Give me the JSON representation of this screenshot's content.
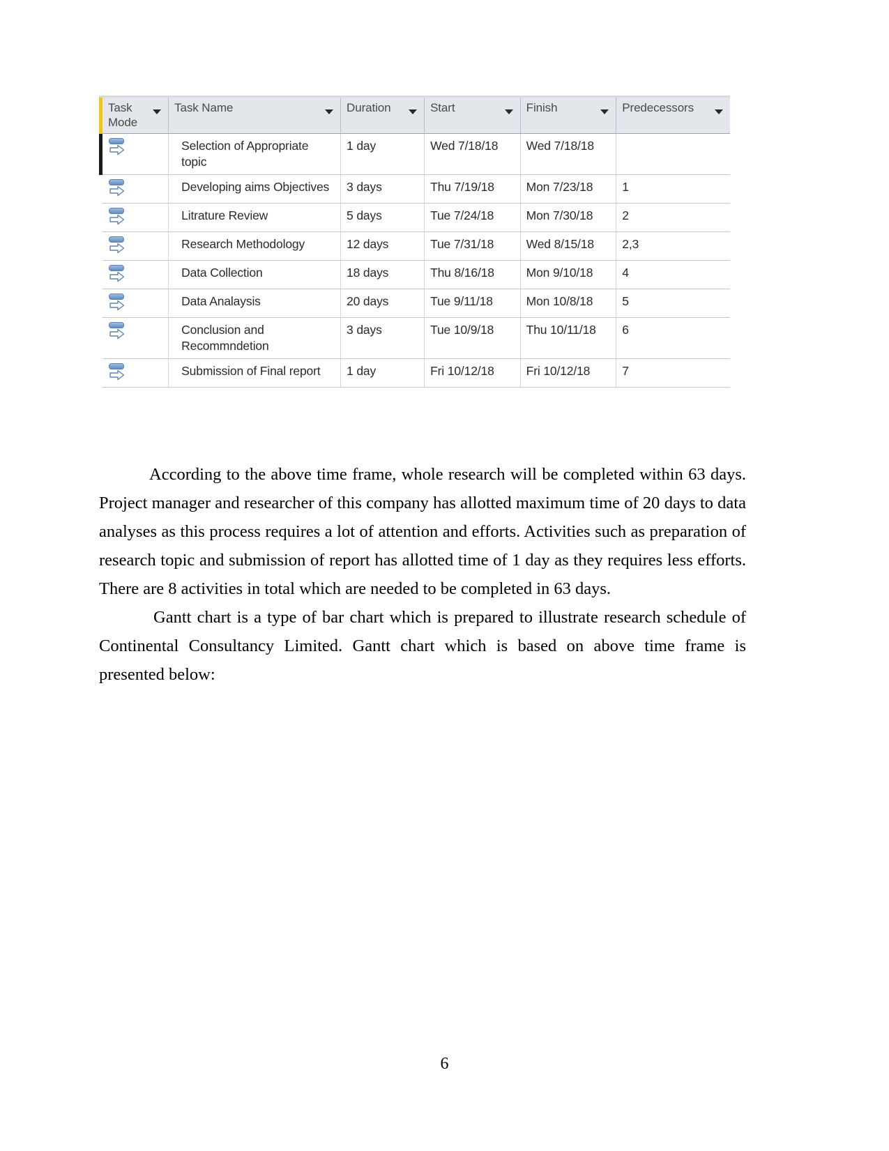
{
  "project_table": {
    "columns": [
      {
        "key": "task_mode",
        "label": "Task Mode",
        "has_filter": true
      },
      {
        "key": "task_name",
        "label": "Task Name",
        "has_filter": true
      },
      {
        "key": "duration",
        "label": "Duration",
        "has_filter": true
      },
      {
        "key": "start",
        "label": "Start",
        "has_filter": true
      },
      {
        "key": "finish",
        "label": "Finish",
        "has_filter": true
      },
      {
        "key": "predecessors",
        "label": "Predecessors",
        "has_filter": true
      }
    ],
    "mode_icon_name": "auto-schedule-icon",
    "accent_bar_color": "#f0c419",
    "header_background": "#e3e6ea",
    "icon_color": "#5f8cc4",
    "rows": [
      {
        "selected": true,
        "task_name": "Selection of Appropriate topic",
        "duration": "1 day",
        "start": "Wed 7/18/18",
        "finish": "Wed 7/18/18",
        "predecessors": ""
      },
      {
        "selected": false,
        "task_name": "Developing aims Objectives",
        "duration": "3 days",
        "start": "Thu 7/19/18",
        "finish": "Mon 7/23/18",
        "predecessors": "1"
      },
      {
        "selected": false,
        "task_name": "Litrature Review",
        "duration": "5 days",
        "start": "Tue 7/24/18",
        "finish": "Mon 7/30/18",
        "predecessors": "2"
      },
      {
        "selected": false,
        "task_name": "Research Methodology",
        "duration": "12 days",
        "start": "Tue 7/31/18",
        "finish": "Wed 8/15/18",
        "predecessors": "2,3"
      },
      {
        "selected": false,
        "task_name": "Data Collection",
        "duration": "18 days",
        "start": "Thu 8/16/18",
        "finish": "Mon 9/10/18",
        "predecessors": "4"
      },
      {
        "selected": false,
        "task_name": "Data Analaysis",
        "duration": "20 days",
        "start": "Tue 9/11/18",
        "finish": "Mon 10/8/18",
        "predecessors": "5"
      },
      {
        "selected": false,
        "task_name": "Conclusion and Recommndetion",
        "duration": "3 days",
        "start": "Tue 10/9/18",
        "finish": "Thu 10/11/18",
        "predecessors": "6"
      },
      {
        "selected": false,
        "task_name": "Submission of Final report",
        "duration": "1 day",
        "start": "Fri 10/12/18",
        "finish": "Fri 10/12/18",
        "predecessors": "7"
      }
    ]
  },
  "body": {
    "paragraph_1": "According to the above time frame, whole research will be completed within 63 days. Project manager and researcher of this company has allotted maximum time of 20 days to data analyses as this process requires a lot of attention and efforts. Activities such as preparation of research topic and submission of report has allotted time of 1 day as they requires less efforts. There are 8 activities in total which are needed to be completed in 63 days.",
    "paragraph_2": "Gantt chart is a type of bar chart which is prepared to illustrate research schedule of Continental Consultancy Limited. Gantt chart which is based on above time frame is presented below:"
  },
  "footer": {
    "page_number": "6"
  }
}
